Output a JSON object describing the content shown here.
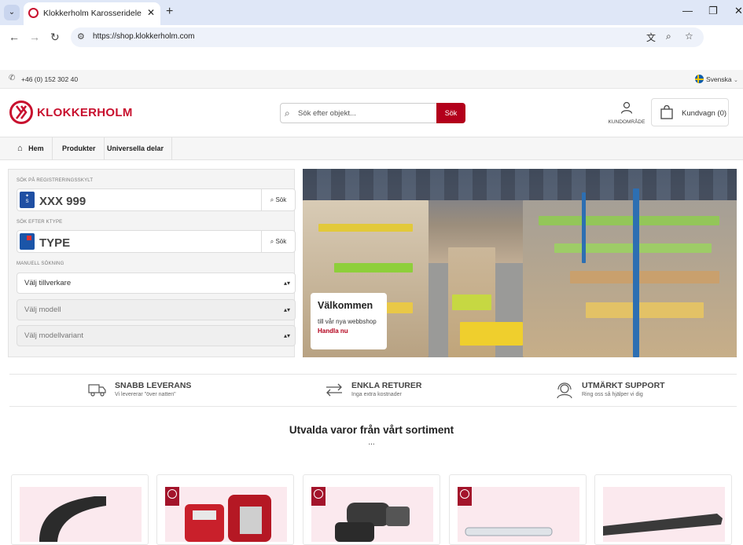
{
  "browser": {
    "tab_title": "Klokkerholm Karosseridele - Fø",
    "url": "https://shop.klokkerholm.com",
    "new_tab": "+",
    "close": "✕"
  },
  "topbar": {
    "phone": "+46 (0) 152 302 40",
    "language": "Svenska"
  },
  "header": {
    "logo_text": "KLOKKERHOLM",
    "search_placeholder": "Sök efter objekt...",
    "search_button": "Sök",
    "account_label": "KUNDOMRÅDE",
    "cart_label": "Kundvagn (0)"
  },
  "nav": {
    "items": [
      "Hem",
      "Produkter",
      "Universella delar"
    ]
  },
  "search_panel": {
    "reg_label": "SÖK PÅ REGISTRERINGSSKYLT",
    "reg_placeholder": "XXX 999",
    "reg_badge": "S",
    "ktype_label": "SÖK EFTER KTYPE",
    "ktype_placeholder": "TYPE",
    "search_button": "Sök",
    "manual_label": "MANUELL SÖKNING",
    "selects": [
      "Välj tillverkare",
      "Välj modell",
      "Välj modellvariant"
    ]
  },
  "hero": {
    "title": "Välkommen",
    "subtitle": "till vår nya webbshop",
    "link": "Handla nu"
  },
  "usps": [
    {
      "icon": "truck-icon",
      "title": "SNABB LEVERANS",
      "subtitle": "Vi levererar \"över natten\""
    },
    {
      "icon": "arrows-icon",
      "title": "ENKLA RETURER",
      "subtitle": "Inga extra kostnader"
    },
    {
      "icon": "support-icon",
      "title": "UTMÄRKT SUPPORT",
      "subtitle": "Ring oss så hjälper vi dig"
    }
  ],
  "featured": {
    "title": "Utvalda varor från vårt sortiment",
    "dots": "..."
  },
  "colors": {
    "brand": "#c8102e",
    "button": "#b3001b"
  }
}
